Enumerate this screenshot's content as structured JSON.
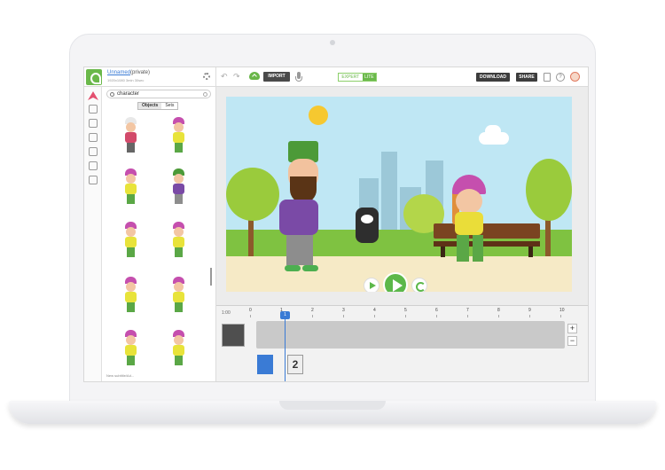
{
  "project": {
    "name": "Unnamed",
    "privacy": "(private)",
    "meta": "1920x1080 3min 30sec"
  },
  "toolbar": {
    "import_label": "IMPORT",
    "mode_expert": "EXPERT",
    "mode_lite": "LITE",
    "download_label": "DOWNLOAD",
    "share_label": "SHARE",
    "help_label": "?"
  },
  "library": {
    "search_value": "character",
    "tabs": [
      {
        "label": "Objects",
        "active": true
      },
      {
        "label": "Sets",
        "active": false
      }
    ],
    "footer": "New subtitle/Ad..."
  },
  "timeline": {
    "total_label": "1:00",
    "ticks": [
      "0",
      "1",
      "2",
      "3",
      "4",
      "5",
      "6",
      "7",
      "8",
      "9",
      "10"
    ],
    "playhead_label": "1",
    "scene_2_label": "2",
    "zoom_in": "+",
    "zoom_out": "−"
  },
  "colors": {
    "accent_green": "#5cb84a",
    "accent_blue": "#3a7bd5",
    "dark_button": "#3d3d3d"
  }
}
